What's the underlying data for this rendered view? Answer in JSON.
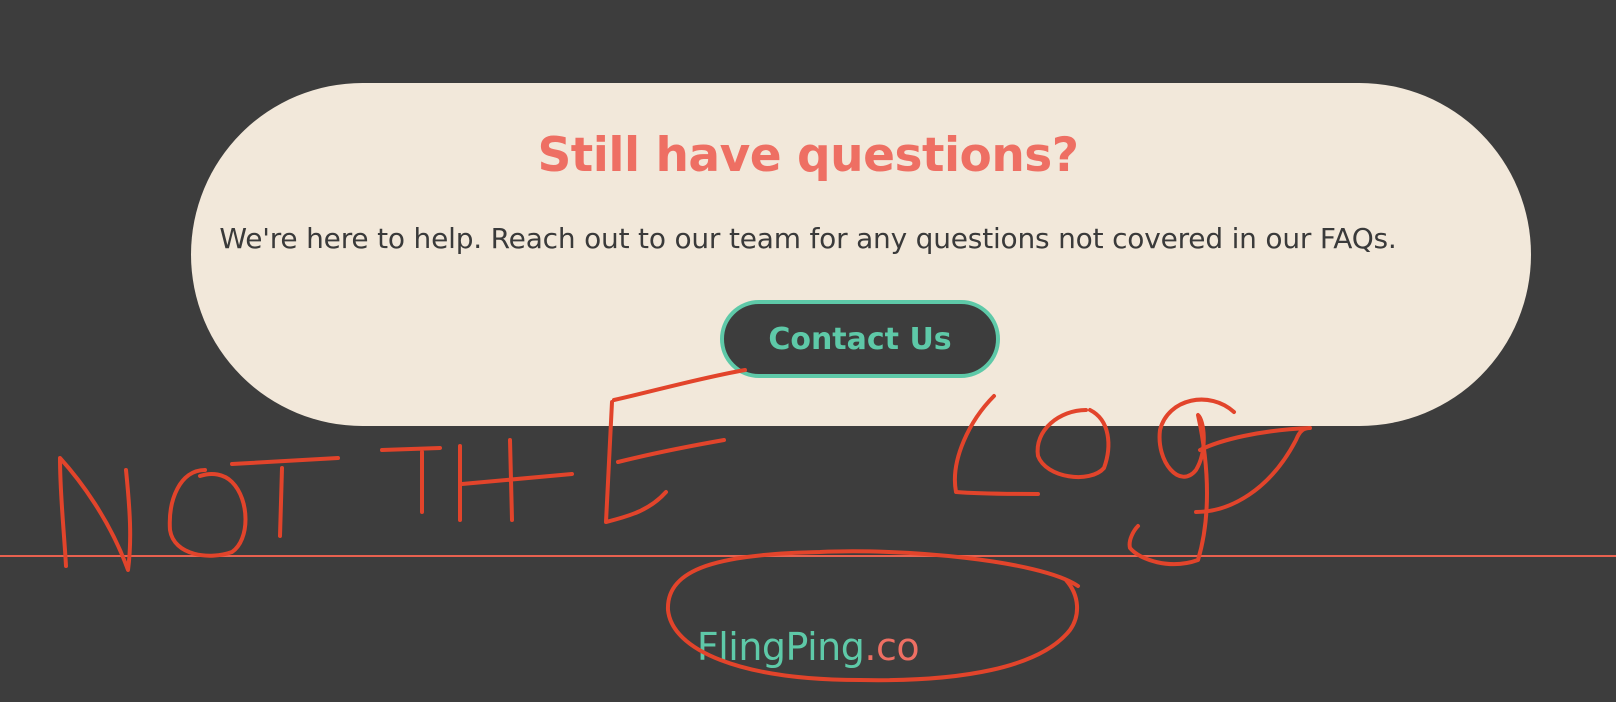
{
  "cta": {
    "heading": "Still have questions?",
    "description": "We're here to help. Reach out to our team for any questions not covered in our FAQs.",
    "button_label": "Contact Us"
  },
  "footer": {
    "logo_main": "FlingPing",
    "logo_tld": ".co"
  },
  "annotation": {
    "handwritten_text": "NOT THE LOGO"
  },
  "colors": {
    "page_background": "#3d3d3d",
    "card_background": "#f2e8da",
    "heading_coral": "#ee6f63",
    "accent_teal": "#5ec9a8",
    "annotation_red": "#e2442b"
  }
}
